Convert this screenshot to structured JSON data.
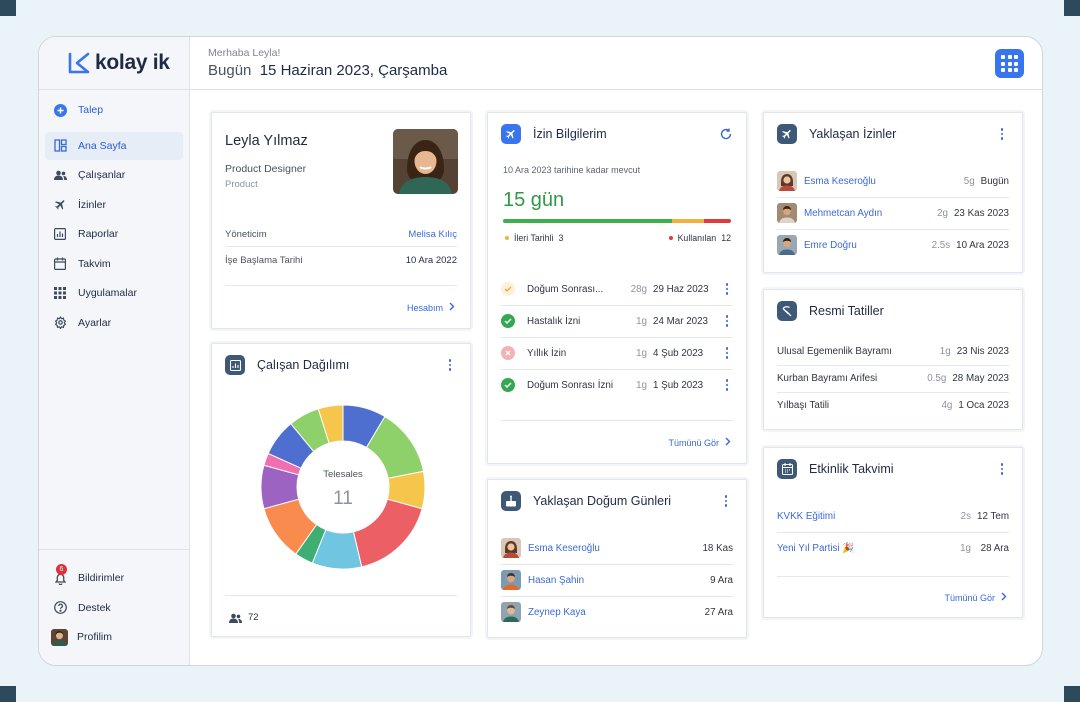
{
  "app": {
    "brand": "kolay ik"
  },
  "header": {
    "greeting": "Merhaba Leyla!",
    "today_label": "Bugün",
    "date": "15 Haziran 2023, Çarşamba"
  },
  "sidebar": {
    "items": [
      {
        "label": "Talep",
        "icon": "plus-circle-icon"
      },
      {
        "label": "Ana Sayfa",
        "icon": "dashboard-icon"
      },
      {
        "label": "Çalışanlar",
        "icon": "people-icon"
      },
      {
        "label": "İzinler",
        "icon": "airplane-icon"
      },
      {
        "label": "Raporlar",
        "icon": "chart-icon"
      },
      {
        "label": "Takvim",
        "icon": "calendar-icon"
      },
      {
        "label": "Uygulamalar",
        "icon": "grid-icon"
      },
      {
        "label": "Ayarlar",
        "icon": "gear-icon"
      }
    ],
    "bottom": [
      {
        "label": "Bildirimler",
        "icon": "bell-icon",
        "badge": "6"
      },
      {
        "label": "Destek",
        "icon": "help-icon"
      },
      {
        "label": "Profilim",
        "icon": "avatar"
      }
    ]
  },
  "profile": {
    "name": "Leyla Yılmaz",
    "title": "Product Designer",
    "department": "Product",
    "manager_label": "Yöneticim",
    "manager": "Melisa Kılıç",
    "start_label": "İşe Başlama Tarihi",
    "start_date": "10 Ara 2022",
    "account_link": "Hesabım"
  },
  "distribution": {
    "title": "Çalışan Dağılımı",
    "center_label": "Telesales",
    "center_value": "11",
    "total": "72"
  },
  "chart_data": {
    "type": "pie",
    "center_label": "Telesales",
    "center_value": 11,
    "values": [
      7,
      11,
      6,
      14,
      8,
      3,
      9,
      7,
      2,
      6,
      5,
      4
    ],
    "colors": [
      "#4f6fd0",
      "#8ed06a",
      "#f5c54c",
      "#ec5f65",
      "#70c5e0",
      "#3fae72",
      "#f98b4e",
      "#9c63c3",
      "#ef6fb1",
      "#4f6fd0",
      "#8ed06a",
      "#f5c54c"
    ]
  },
  "leave": {
    "title": "İzin Bilgilerim",
    "available_until": "10 Ara 2023 tarihine kadar mevcut",
    "days": "15 gün",
    "progress": {
      "green": 0.74,
      "yellow": 0.14,
      "red": 0.12
    },
    "future_label": "İleri Tarihli",
    "future_value": "3",
    "used_label": "Kullanılan",
    "used_value": "12",
    "items": [
      {
        "name": "Doğum Sonrası...",
        "dur": "28g",
        "date": "29 Haz 2023",
        "status": "pending"
      },
      {
        "name": "Hastalık İzni",
        "dur": "1g",
        "date": "24 Mar 2023",
        "status": "approved"
      },
      {
        "name": "Yıllık İzin",
        "dur": "1g",
        "date": "4 Şub 2023",
        "status": "rejected"
      },
      {
        "name": "Doğum Sonrası İzni",
        "dur": "1g",
        "date": "1 Şub 2023",
        "status": "approved"
      }
    ],
    "see_all": "Tümünü Gör"
  },
  "birthdays": {
    "title": "Yaklaşan Doğum Günleri",
    "items": [
      {
        "name": "Esma Keseroğlu",
        "date": "18 Kas"
      },
      {
        "name": "Hasan Şahin",
        "date": "9 Ara"
      },
      {
        "name": "Zeynep Kaya",
        "date": "27 Ara"
      }
    ]
  },
  "upcoming": {
    "title": "Yaklaşan İzinler",
    "items": [
      {
        "name": "Esma Keseroğlu",
        "dur": "5g",
        "date": "Bugün"
      },
      {
        "name": "Mehmetcan Aydın",
        "dur": "2g",
        "date": "23 Kas 2023"
      },
      {
        "name": "Emre Doğru",
        "dur": "2.5s",
        "date": "10 Ara 2023"
      }
    ]
  },
  "holidays": {
    "title": "Resmi Tatiller",
    "items": [
      {
        "name": "Ulusal Egemenlik Bayramı",
        "dur": "1g",
        "date": "23 Nis 2023"
      },
      {
        "name": "Kurban Bayramı Arifesi",
        "dur": "0.5g",
        "date": "28 May 2023"
      },
      {
        "name": "Yılbaşı Tatili",
        "dur": "4g",
        "date": "1 Oca 2023"
      }
    ]
  },
  "events": {
    "title": "Etkinlik Takvimi",
    "items": [
      {
        "name": "KVKK Eğitimi",
        "dur": "2s",
        "date": "12 Tem"
      },
      {
        "name": "Yeni Yıl Partisi 🎉",
        "dur": "1g",
        "date": "28 Ara"
      }
    ],
    "see_all": "Tümünü Gör"
  },
  "colors": {
    "accent": "#3875ee",
    "green": "#3fae4d",
    "yellow": "#f2b23a",
    "red": "#e03b3b",
    "icon_bg": "#3e5878"
  }
}
